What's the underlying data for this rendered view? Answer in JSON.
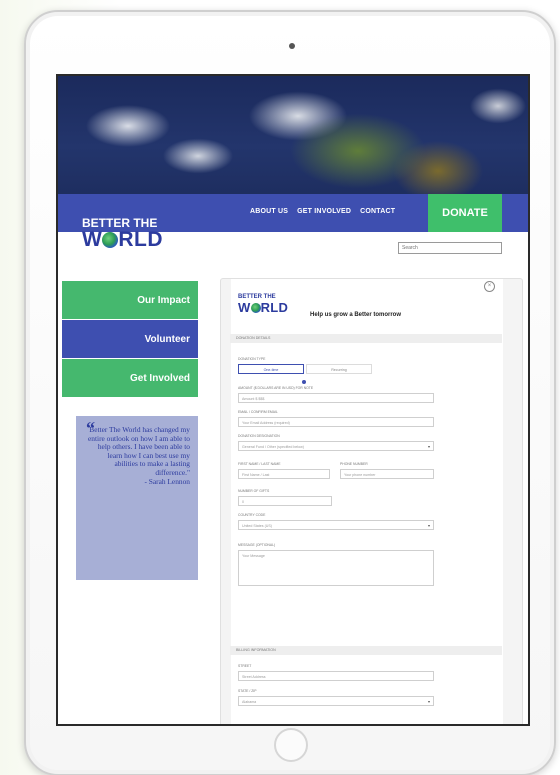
{
  "nav": {
    "about": "ABOUT US",
    "get_involved": "GET INVOLVED",
    "contact": "CONTACT",
    "donate": "DONATE"
  },
  "logo": {
    "line1": "BETTER THE",
    "line2_a": "W",
    "line2_b": "RLD"
  },
  "search": {
    "placeholder": "Search"
  },
  "sidebar": {
    "items": [
      {
        "label": "Our Impact"
      },
      {
        "label": "Volunteer"
      },
      {
        "label": "Get Involved"
      }
    ]
  },
  "quote": {
    "mark": "“",
    "text": "Better The World has changed my entire outlook on how I am able to help others. I have been able to learn how I can best use my abilities to make a lasting difference.\"",
    "author": "- Sarah Lennon"
  },
  "form": {
    "headline": "Help us grow a Better tomorrow",
    "close_glyph": "×",
    "sections": {
      "donation": "DONATION DETAILS",
      "billing": "BILLING INFORMATION"
    },
    "donation_type": {
      "label": "DONATION TYPE",
      "options": [
        "One-time",
        "Recurring"
      ]
    },
    "fields": {
      "amount_label": "AMOUNT ($ DOLLARS ARE IN USD) FOR NOTE",
      "amount_placeholder": "Amount $ $$$",
      "email_label": "EMAIL / CONFIRM EMAIL",
      "email_placeholder": "Your Email Address (required)",
      "designation_label": "DONATION DESIGNATION",
      "designation_value": "General Fund / Other (specified below)",
      "first_name_label": "FIRST NAME / LAST NAME",
      "first_name_placeholder": "First Name / Last",
      "phone_label": "PHONE NUMBER",
      "phone_placeholder": "Your phone number",
      "gifts_label": "NUMBER OF GIFTS",
      "gifts_value": "0",
      "country_label": "COUNTRY CODE",
      "country_value": "United States (US)",
      "message_label": "MESSAGE (OPTIONAL)",
      "message_placeholder": "Your Message",
      "address_label": "STREET",
      "address_placeholder": "Street Address",
      "state_label": "STATE / ZIP",
      "state_value": "Alabama"
    }
  }
}
